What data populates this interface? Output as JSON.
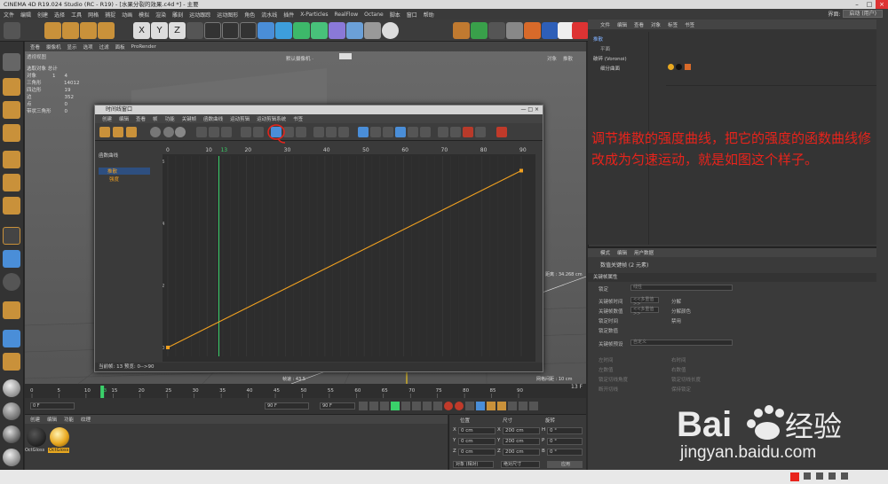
{
  "window": {
    "title": "CINEMA 4D R19.024 Studio (RC - R19) - [水果分裂的效果.c4d *] - 主要"
  },
  "menubar": [
    "文件",
    "编辑",
    "创建",
    "选择",
    "工具",
    "网格",
    "捕捉",
    "动画",
    "模拟",
    "渲染",
    "雕刻",
    "运动跟踪",
    "运动图形",
    "角色",
    "流水线",
    "插件",
    "X-Particles",
    "RealFlow",
    "Octane",
    "脚本",
    "窗口",
    "帮助"
  ],
  "interface": {
    "label": "界面:",
    "value": "启动 (用户)"
  },
  "viewport": {
    "menu": [
      "查看",
      "摄像机",
      "显示",
      "选项",
      "过滤",
      "面板",
      "ProRender"
    ],
    "camera_label": "默认摄像机 ·",
    "view_name": "透视视图",
    "stats": {
      "header": "选取对象  总计",
      "rows": [
        [
          "对象",
          "1",
          "4"
        ],
        [
          "三角形",
          "",
          "14012"
        ],
        [
          "四边形",
          "",
          "19"
        ],
        [
          "边",
          "",
          "352"
        ],
        [
          "点",
          "",
          "0"
        ],
        [
          "带状三角形",
          "",
          "0"
        ]
      ]
    },
    "grid_label": "网格间距 : 10 cm",
    "distance": "距离 : 34.268 cm"
  },
  "timeline_window": {
    "title": "时间线窗口",
    "menu": [
      "创建",
      "编辑",
      "查看",
      "帧",
      "功能",
      "关键帧",
      "函数曲线",
      "运动剪辑",
      "运动剪辑系统",
      "书签"
    ],
    "tree": {
      "header": "函数曲线",
      "items": [
        "推散",
        "强度"
      ]
    },
    "ruler": [
      "0",
      "10",
      "13",
      "20",
      "30",
      "40",
      "50",
      "60",
      "70",
      "80",
      "90"
    ],
    "ylabels": [
      "6",
      "4",
      "2",
      "0"
    ],
    "footer": "当前帧: 13  预览: 0-->90",
    "curve_color": "#f0a020",
    "curve": {
      "start": [
        0,
        0
      ],
      "end": [
        90,
        5.7
      ]
    }
  },
  "object_manager": {
    "menu": [
      "文件",
      "编辑",
      "查看",
      "对象",
      "标签",
      "书签"
    ],
    "objects": [
      "推散",
      "平面",
      "破碎 (Voronoi)",
      "细分曲面"
    ]
  },
  "annotation": "调节推散的强度曲线，把它的强度的函数曲线修改成为匀速运动，就是如图这个样子。",
  "attribute_manager": {
    "menu": [
      "模式",
      "编辑",
      "用户数据"
    ],
    "subtitle": "数值关键帧 (2 元素)",
    "section": "关键帧属性",
    "rows": [
      {
        "label": "锁定",
        "value": "线性"
      },
      {
        "label": "关键帧时间",
        "value": "<<多重值>>"
      },
      {
        "label": "关键帧数值",
        "value": "<<多重值>>"
      },
      {
        "label": "锁定时间",
        "value": ""
      },
      {
        "label": "锁定数值",
        "value": ""
      },
      {
        "label": "关键帧预设",
        "value": "自定义"
      }
    ],
    "right_labels": [
      "分解",
      "分解颜色",
      "禁用"
    ],
    "lower_rows": [
      "左时间",
      "左数值",
      "锁定切线角度",
      "断开切线",
      "右时间",
      "右数值",
      "锁定切线长度",
      "保持锁定"
    ]
  },
  "timeline": {
    "ticks": [
      "0",
      "5",
      "10",
      "13",
      "15",
      "20",
      "25",
      "30",
      "35",
      "40",
      "45",
      "50",
      "55",
      "60",
      "65",
      "70",
      "75",
      "80",
      "85",
      "90"
    ],
    "current": "13 F",
    "start": "0 F",
    "end_a": "90 F",
    "end_b": "90 F",
    "fps_label": "帧速 : 43.5"
  },
  "materials": {
    "menu": [
      "创建",
      "编辑",
      "功能",
      "纹理"
    ],
    "items": [
      {
        "name": "OctGloss",
        "color": "#1a1a1a"
      },
      {
        "name": "OctGloss",
        "color": "#e8a820"
      }
    ]
  },
  "coordinates": {
    "headers": [
      "位置",
      "尺寸",
      "旋转"
    ],
    "rows": [
      {
        "axis": "X",
        "pos": "0 cm",
        "size": "200 cm",
        "rot_axis": "H",
        "rot": "0 °"
      },
      {
        "axis": "Y",
        "pos": "0 cm",
        "size": "200 cm",
        "rot_axis": "P",
        "rot": "0 °"
      },
      {
        "axis": "Z",
        "pos": "0 cm",
        "size": "200 cm",
        "rot_axis": "B",
        "rot": "0 °"
      }
    ],
    "mode": "对象 (相对)",
    "size_mode": "绝对尺寸",
    "apply": "应用"
  },
  "watermark": {
    "brand": "Bai 经验",
    "url": "jingyan.baidu.com"
  },
  "colors": {
    "accent_red": "#e8231b",
    "curve": "#f0a020",
    "playhead": "#3ad16a"
  }
}
